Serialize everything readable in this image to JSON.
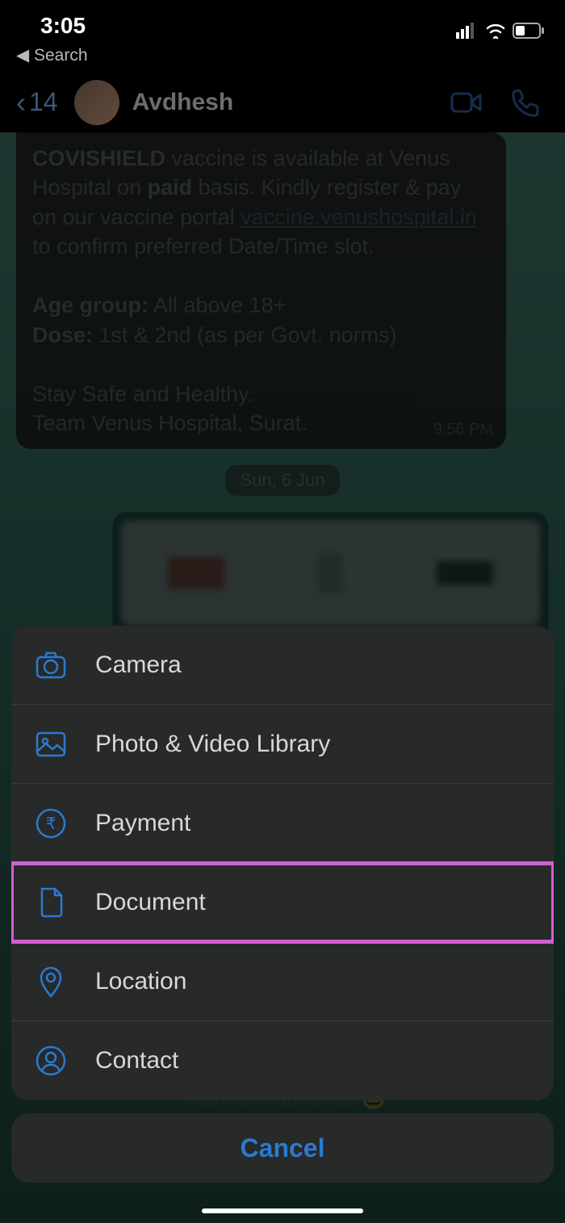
{
  "status": {
    "time": "3:05",
    "back_app": "Search"
  },
  "nav": {
    "back_count": "14",
    "contact_name": "Avdhesh"
  },
  "message": {
    "line1_a": "COVISHIELD",
    "line1_b": " vaccine is available at Venus Hospital on ",
    "line1_c": "paid",
    "line1_d": " basis. Kindly register & pay on our vaccine portal ",
    "link": "vaccine.venushospital.in",
    "line1_e": " to confirm preferred Date/Time slot.",
    "age_label": "Age group:",
    "age_val": " All above 18+",
    "dose_label": "Dose:",
    "dose_val": " 1st & 2nd (as per Govt. norms)",
    "line3": "Stay Safe and Healthy.",
    "line4": "Team Venus Hospital, Surat.",
    "time": "9:56 PM"
  },
  "date_separator": "Sun, 6 Jun",
  "thanks_line": "Thanks in advance 😅",
  "menu": {
    "camera": "Camera",
    "photo": "Photo & Video Library",
    "payment": "Payment",
    "document": "Document",
    "location": "Location",
    "contact": "Contact"
  },
  "cancel_label": "Cancel"
}
